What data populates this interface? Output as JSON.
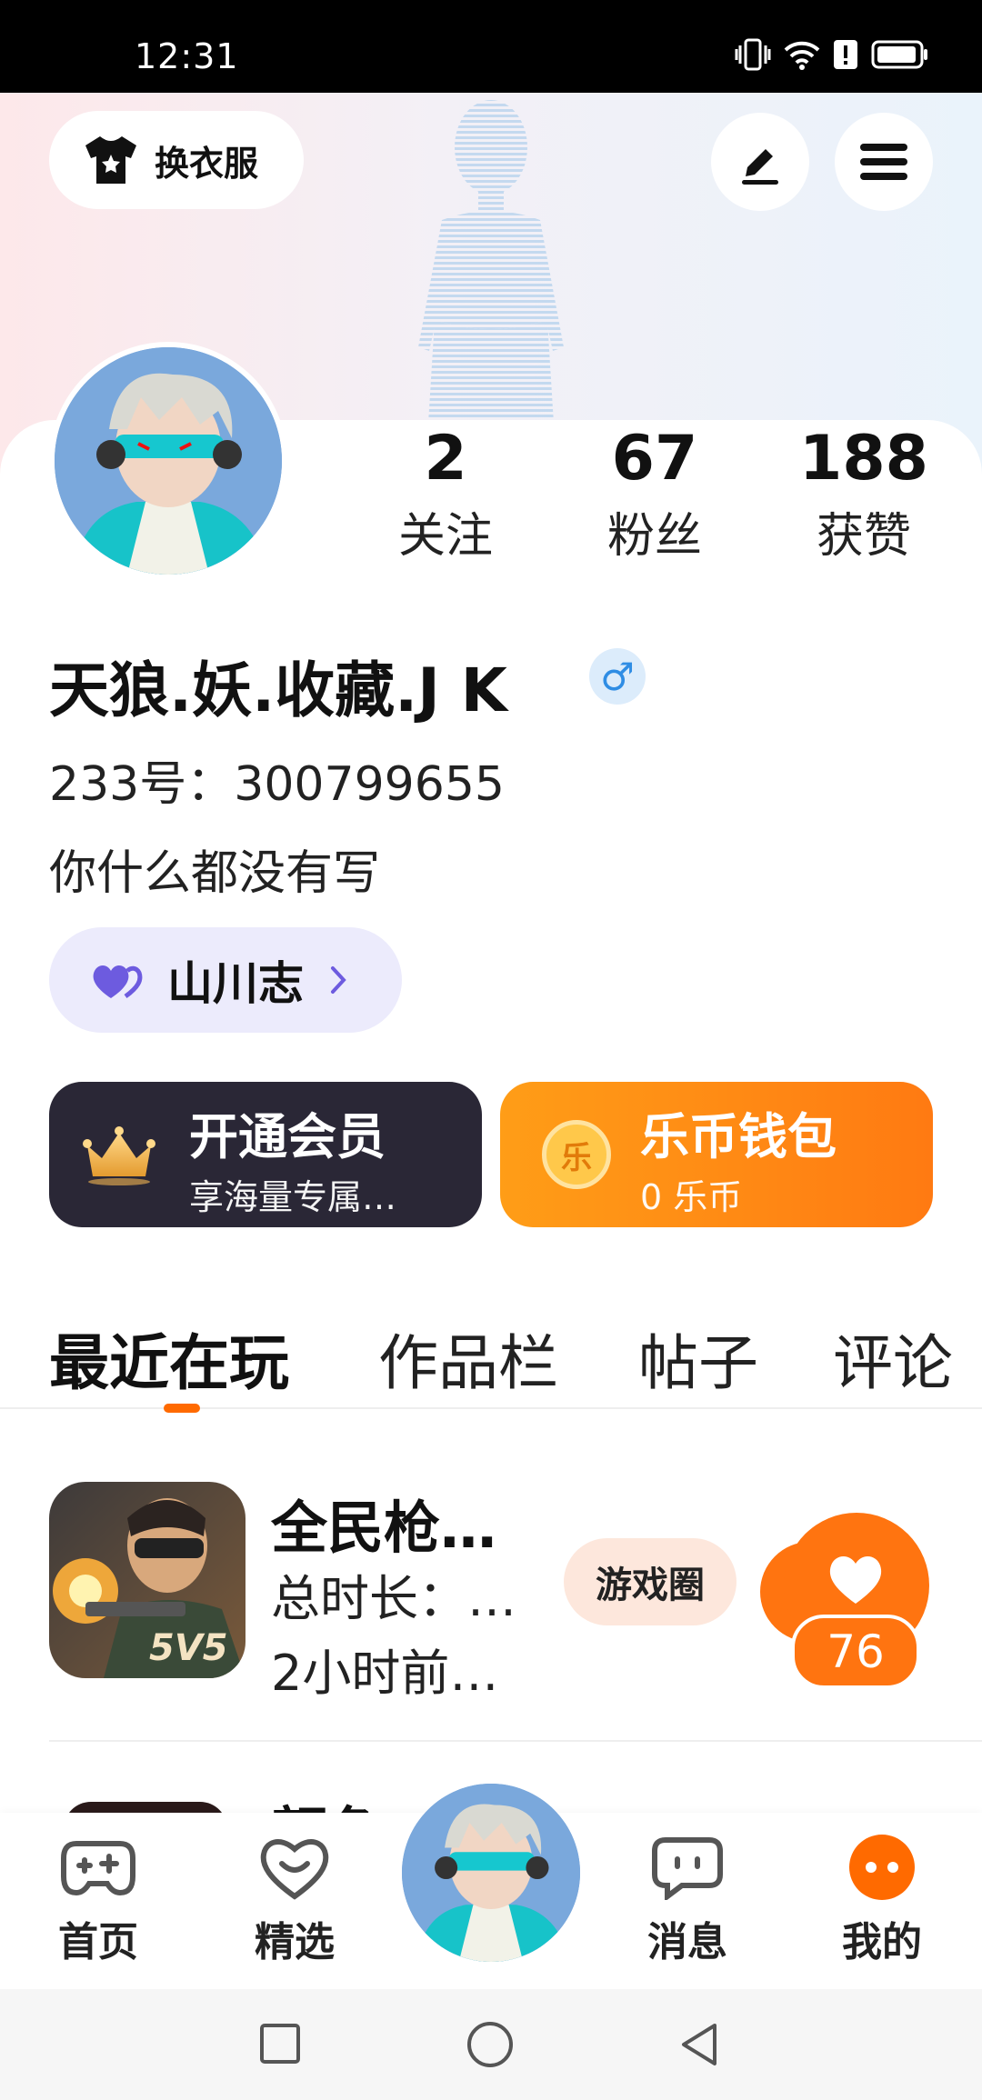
{
  "status_bar": {
    "time": "12:31"
  },
  "header": {
    "outfit_label": "换衣服",
    "edit_icon": "edit-icon",
    "menu_icon": "menu-icon"
  },
  "profile": {
    "stats": [
      {
        "num": "2",
        "label": "关注"
      },
      {
        "num": "67",
        "label": "粉丝"
      },
      {
        "num": "188",
        "label": "获赞"
      }
    ],
    "username": "天狼.妖.收藏.J K",
    "gender": "♂",
    "user_id": "233号：300799655",
    "bio": "你什么都没有写",
    "chip_label": "山川志"
  },
  "cards": {
    "vip": {
      "title": "开通会员",
      "sub": "享海量专属…"
    },
    "wallet": {
      "title": "乐币钱包",
      "sub": "0 乐币",
      "coin_char": "乐"
    }
  },
  "tabs": [
    {
      "label": "最近在玩",
      "active": true
    },
    {
      "label": "作品栏",
      "active": false
    },
    {
      "label": "帖子",
      "active": false
    },
    {
      "label": "评论",
      "active": false
    }
  ],
  "games": [
    {
      "name": "全民枪…",
      "duration": "总时长：…",
      "ago": "2小时前…",
      "tag": "游戏圈",
      "likes": "76",
      "icon_text": "5V5"
    },
    {
      "name": "颜色…"
    }
  ],
  "nav": [
    {
      "label": "首页",
      "icon": "gamepad-icon"
    },
    {
      "label": "精选",
      "icon": "heart-badge-icon"
    },
    {
      "label": "",
      "icon": "avatar"
    },
    {
      "label": "消息",
      "icon": "chat-icon"
    },
    {
      "label": "我的",
      "icon": "profile-dots-icon"
    }
  ],
  "colors": {
    "accent": "#ff7410",
    "vip_bg": "#2a2736",
    "chip_bg": "#ecebfc",
    "gender_blue": "#2f8de4"
  }
}
